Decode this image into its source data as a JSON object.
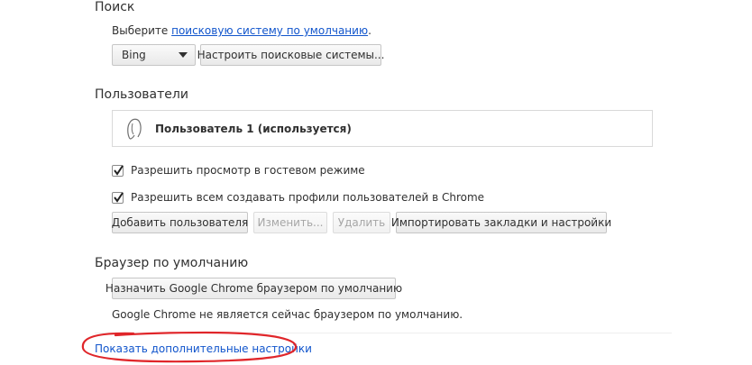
{
  "search": {
    "title": "Поиск",
    "prefix": "Выберите ",
    "link": "поисковую систему по умолчанию",
    "suffix": ".",
    "engine_selected": "Bing",
    "manage_button": "Настроить поисковые системы..."
  },
  "users": {
    "title": "Пользователи",
    "current_user": "Пользователь 1 (используется)",
    "guest_checkbox": "Разрешить просмотр в гостевом режиме",
    "guest_checked": true,
    "profiles_checkbox": "Разрешить всем создавать профили пользователей в Chrome",
    "profiles_checked": true,
    "add_button": "Добавить пользователя",
    "edit_button": "Изменить...",
    "delete_button": "Удалить",
    "import_button": "Импортировать закладки и настройки"
  },
  "default_browser": {
    "title": "Браузер по умолчанию",
    "make_default_button": "Назначить Google Chrome браузером по умолчанию",
    "status_text": "Google Chrome не является сейчас браузером по умолчанию."
  },
  "advanced": {
    "link": "Показать дополнительные настройки"
  },
  "colors": {
    "link": "#1155cc",
    "annotation": "#e0262a"
  }
}
